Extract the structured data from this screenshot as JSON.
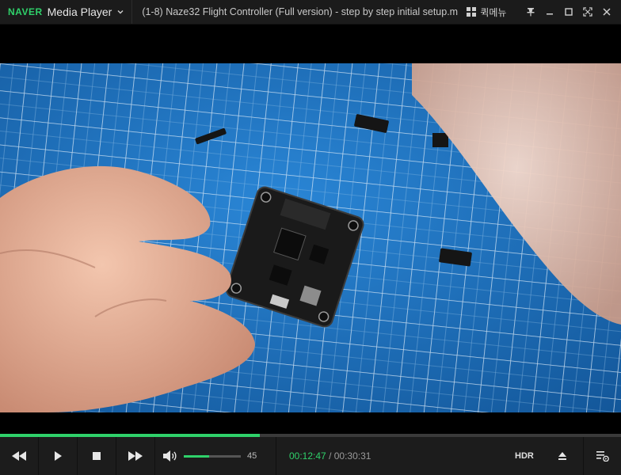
{
  "app": {
    "brand": "NAVER",
    "name": "Media Player",
    "title": "(1-8) Naze32 Flight Controller (Full version) - step by step initial setup.m...",
    "quick_menu": "퀵메뉴"
  },
  "player": {
    "progress_fraction": 0.418,
    "volume": "45",
    "volume_fraction": 0.45,
    "current_time": "00:12:47",
    "total_time": "/ 00:30:31",
    "hdr_label": "HDR"
  },
  "icons": {
    "menu": "chevron-down-icon",
    "quick_menu": "grid-icon",
    "pin": "pin-icon",
    "minimize": "minimize-icon",
    "maximize": "maximize-icon",
    "fullscreen": "fullscreen-icon",
    "close": "close-icon",
    "rewind": "rewind-icon",
    "play": "play-icon",
    "stop": "stop-icon",
    "forward": "fast-forward-icon",
    "volume": "speaker-icon",
    "eject": "eject-icon",
    "playlist": "playlist-icon"
  },
  "colors": {
    "accent": "#2fd16a",
    "titlebar": "#1b1b1b",
    "controls": "#1c1c1c"
  }
}
